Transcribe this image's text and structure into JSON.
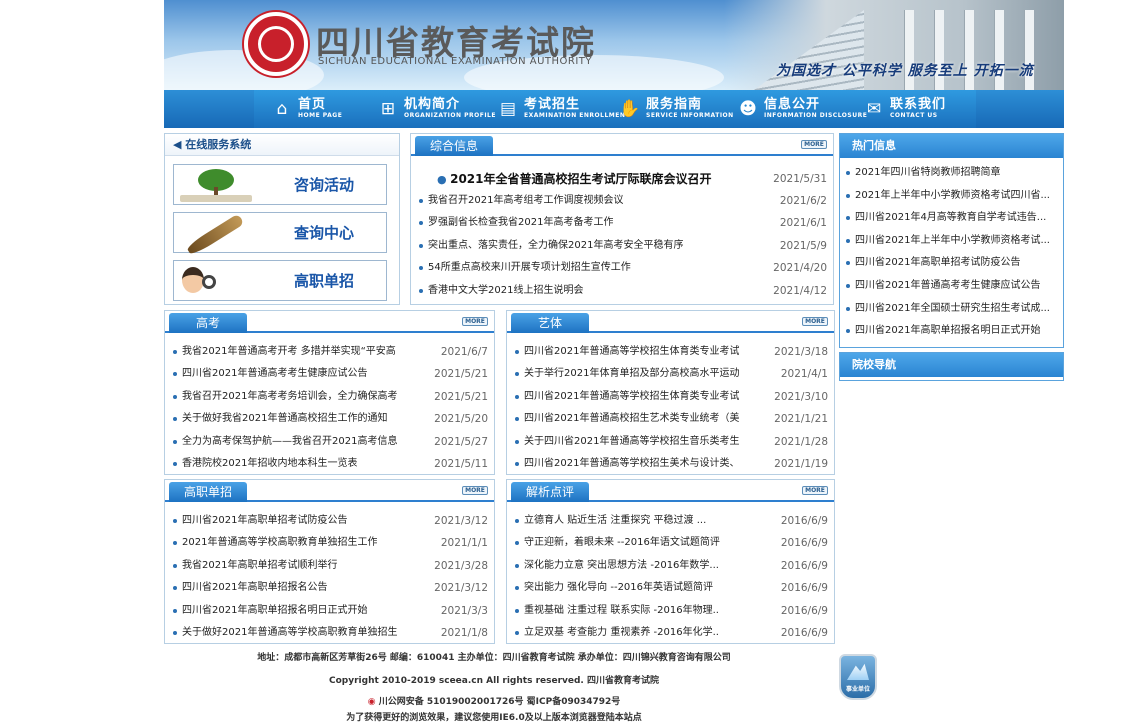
{
  "header": {
    "title": "四川省教育考试院",
    "subtitle": "SICHUAN EDUCATIONAL EXAMINATION AUTHORITY",
    "slogan": "为国选才 公平科学 服务至上 开拓一流"
  },
  "nav": [
    {
      "label": "首页",
      "en": "HOME PAGE",
      "icon": "home-icon"
    },
    {
      "label": "机构简介",
      "en": "ORGANIZATION PROFILE",
      "icon": "org-icon"
    },
    {
      "label": "考试招生",
      "en": "EXAMINATION ENROLLMENT",
      "icon": "exam-icon"
    },
    {
      "label": "服务指南",
      "en": "SERVICE INFORMATION",
      "icon": "handshake-icon"
    },
    {
      "label": "信息公开",
      "en": "INFORMATION DISCLOSURE",
      "icon": "people-icon"
    },
    {
      "label": "联系我们",
      "en": "CONTACT US",
      "icon": "contact-icon"
    }
  ],
  "service": {
    "title": "在线服务系统",
    "buttons": [
      "咨询活动",
      "查询中心",
      "高职单招"
    ]
  },
  "more_label": "MORE",
  "general": {
    "tab": "综合信息",
    "headline": {
      "text": "2021年全省普通高校招生考试厅际联席会议召开",
      "date": "2021/5/31"
    },
    "items": [
      {
        "text": "我省召开2021年高考组考工作调度视频会议",
        "date": "2021/6/2"
      },
      {
        "text": "罗强副省长检查我省2021年高考备考工作",
        "date": "2021/6/1"
      },
      {
        "text": "突出重点、落实责任，全力确保2021年高考安全平稳有序",
        "date": "2021/5/9"
      },
      {
        "text": "54所重点高校来川开展专项计划招生宣传工作",
        "date": "2021/4/20"
      },
      {
        "text": "香港中文大学2021线上招生说明会",
        "date": "2021/4/12"
      }
    ]
  },
  "gaokao": {
    "tab": "高考",
    "items": [
      {
        "text": "我省2021年普通高考开考 多措并举实现“平安高",
        "date": "2021/6/7"
      },
      {
        "text": "四川省2021年普通高考考生健康应试公告",
        "date": "2021/5/21"
      },
      {
        "text": "我省召开2021年高考考务培训会，全力确保高考",
        "date": "2021/5/21"
      },
      {
        "text": "关于做好我省2021年普通高校招生工作的通知",
        "date": "2021/5/20"
      },
      {
        "text": "全力为高考保驾护航——我省召开2021高考信息",
        "date": "2021/5/27"
      },
      {
        "text": "香港院校2021年招收内地本科生一览表",
        "date": "2021/5/11"
      }
    ]
  },
  "art": {
    "tab": "艺体",
    "items": [
      {
        "text": "四川省2021年普通高等学校招生体育类专业考试",
        "date": "2021/3/18"
      },
      {
        "text": "关于举行2021年体育单招及部分高校高水平运动",
        "date": "2021/4/1"
      },
      {
        "text": "四川省2021年普通高等学校招生体育类专业考试",
        "date": "2021/3/10"
      },
      {
        "text": "四川省2021年普通高校招生艺术类专业统考（美",
        "date": "2021/1/21"
      },
      {
        "text": "关于四川省2021年普通高等学校招生音乐类考生",
        "date": "2021/1/28"
      },
      {
        "text": "四川省2021年普通高等学校招生美术与设计类、",
        "date": "2021/1/19"
      }
    ]
  },
  "vocational": {
    "tab": "高职单招",
    "items": [
      {
        "text": "四川省2021年高职单招考试防疫公告",
        "date": "2021/3/12"
      },
      {
        "text": "2021年普通高等学校高职教育单独招生工作",
        "date": "2021/1/1"
      },
      {
        "text": "我省2021年高职单招考试顺利举行",
        "date": "2021/3/28"
      },
      {
        "text": "四川省2021年高职单招报名公告",
        "date": "2021/3/12"
      },
      {
        "text": "四川省2021年高职单招报名明日正式开始",
        "date": "2021/3/3"
      },
      {
        "text": "关于做好2021年普通高等学校高职教育单独招生",
        "date": "2021/1/8"
      }
    ]
  },
  "analysis": {
    "tab": "解析点评",
    "items": [
      {
        "text": "立德育人 贴近生活 注重探究 平稳过渡 ...",
        "date": "2016/6/9"
      },
      {
        "text": "守正迎新，着眼未来 --2016年语文试题简评",
        "date": "2016/6/9"
      },
      {
        "text": "深化能力立意 突出思想方法 -2016年数学...",
        "date": "2016/6/9"
      },
      {
        "text": "突出能力 强化导向 --2016年英语试题简评",
        "date": "2016/6/9"
      },
      {
        "text": "重视基础 注重过程 联系实际 -2016年物理..",
        "date": "2016/6/9"
      },
      {
        "text": "立足双基 考查能力 重视素养 -2016年化学..",
        "date": "2016/6/9"
      }
    ]
  },
  "hot": {
    "title": "热门信息",
    "items": [
      "2021年四川省特岗教师招聘简章",
      "2021年上半年中小学教师资格考试四川省...",
      "四川省2021年4月高等教育自学考试违告...",
      "四川省2021年上半年中小学教师资格考试...",
      "四川省2021年高职单招考试防疫公告",
      "四川省2021年普通高考考生健康应试公告",
      "四川省2021年全国硕士研究生招生考试成...",
      "四川省2021年高职单招报名明日正式开始"
    ]
  },
  "links_title": "院校导航",
  "footer": {
    "address": "地址：成都市高新区芳草街26号 邮编：610041 主办单位：四川省教育考试院 承办单位：四川锦兴教育咨询有限公司",
    "copyright": "Copyright 2010-2019 sceea.cn All rights reserved. 四川省教育考试院",
    "icp": "川公网安备 51019002001726号    蜀ICP备09034792号",
    "note": "为了获得更好的浏览效果，建议您使用IE6.0及以上版本浏览器登陆本站点",
    "badge": "事业单位"
  }
}
